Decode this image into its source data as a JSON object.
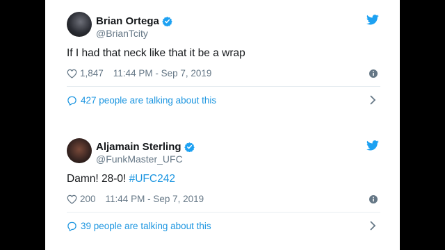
{
  "tweets": [
    {
      "name": "Brian Ortega",
      "handle": "@BrianTcity",
      "text": "If I had that neck like that it be a wrap",
      "likes": "1,847",
      "timestamp": "11:44 PM - Sep 7, 2019",
      "talking": "427 people are talking about this"
    },
    {
      "name": "Aljamain Sterling",
      "handle": "@FunkMaster_UFC",
      "text_plain": "Damn! 28-0! ",
      "hashtag": "#UFC242",
      "likes": "200",
      "timestamp": "11:44 PM - Sep 7, 2019",
      "talking": "39 people are talking about this"
    }
  ],
  "icons": {
    "verified": "verified-badge-icon",
    "bird": "twitter-bird-icon",
    "heart": "heart-icon",
    "info": "info-icon",
    "bubble": "speech-bubble-icon",
    "chevron": "chevron-right-icon"
  },
  "colors": {
    "accent": "#1da1f2",
    "link": "#1b95e0",
    "muted": "#657786",
    "text": "#14171a",
    "background": "#000000"
  }
}
